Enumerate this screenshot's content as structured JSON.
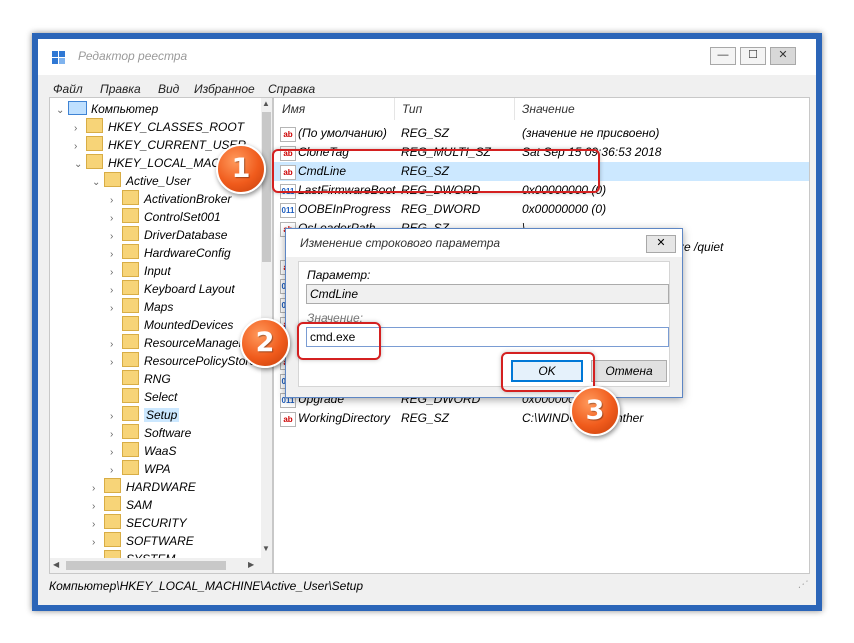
{
  "window": {
    "title": "Редактор реестра",
    "min_glyph": "—",
    "max_glyph": "☐",
    "close_glyph": "✕"
  },
  "menu": [
    "Файл",
    "Правка",
    "Вид",
    "Избранное",
    "Справка"
  ],
  "tree": {
    "root": "Компьютер",
    "items": [
      "HKEY_CLASSES_ROOT",
      "HKEY_CURRENT_USER",
      "HKEY_LOCAL_MACHINE",
      "Active_User",
      "ActivationBroker",
      "ControlSet001",
      "DriverDatabase",
      "HardwareConfig",
      "Input",
      "Keyboard Layout",
      "Maps",
      "MountedDevices",
      "ResourceManager",
      "ResourcePolicyStore",
      "RNG",
      "Select",
      "Setup",
      "Software",
      "WaaS",
      "WPA",
      "HARDWARE",
      "SAM",
      "SECURITY",
      "SOFTWARE",
      "SYSTEM"
    ],
    "selected": "Setup"
  },
  "list": {
    "columns": {
      "name": "Имя",
      "type": "Тип",
      "data": "Значение"
    },
    "rows": [
      {
        "name": "(По умолчанию)",
        "type": "REG_SZ",
        "data": "(значение не присвоено)"
      },
      {
        "name": "CloneTag",
        "type": "REG_MULTI_SZ",
        "data": "Sat Sep 15 09:36:53 2018"
      },
      {
        "name": "CmdLine",
        "type": "REG_SZ",
        "data": ""
      },
      {
        "name": "LastFirmwareBoot",
        "type": "REG_DWORD",
        "data": "0x00000000 (0)"
      },
      {
        "name": "OOBEInProgress",
        "type": "REG_DWORD",
        "data": "0x00000000 (0)"
      },
      {
        "name": "OsLoaderPath",
        "type": "REG_SZ",
        "data": "\\"
      },
      {
        "name": "Upgrade",
        "type": "REG_DWORD",
        "data": "0x00000000 (0)"
      },
      {
        "name": "WorkingDirectory",
        "type": "REG_SZ",
        "data": "C:\\WINDOWS\\Panther"
      }
    ],
    "partial_text": "ze /quiet"
  },
  "statusbar": {
    "path": "Компьютер\\HKEY_LOCAL_MACHINE\\Active_User\\Setup"
  },
  "dialog": {
    "title": "Изменение строкового параметра",
    "param_label": "Параметр:",
    "param_value": "CmdLine",
    "value_label": "Значение:",
    "value_value": "cmd.exe",
    "ok_label": "OK",
    "cancel_label": "Отмена",
    "close_glyph": "✕"
  },
  "badges": [
    "1",
    "2",
    "3"
  ],
  "colors": {
    "badge": "#f05b1c",
    "highlight": "#d42020",
    "selection": "#cce8ff",
    "window_frame": "#2b65b8"
  }
}
